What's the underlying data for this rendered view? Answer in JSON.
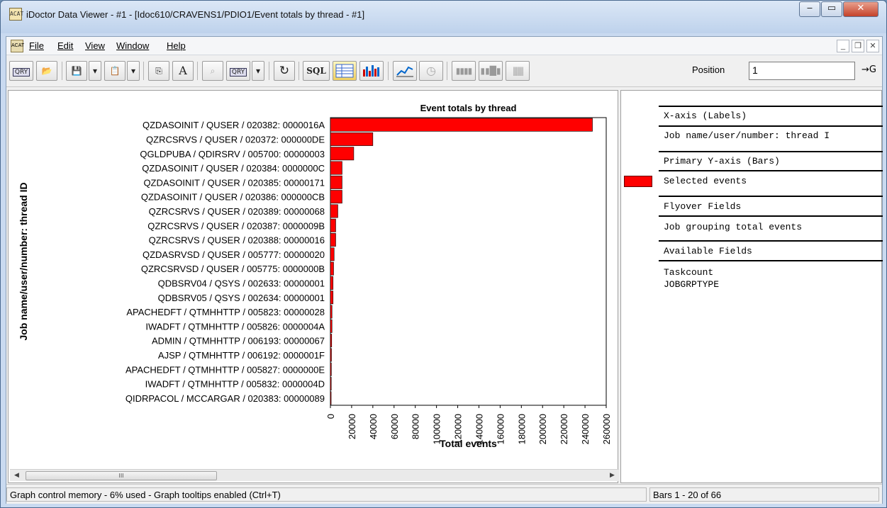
{
  "window": {
    "title": "iDoctor Data Viewer - #1 - [Idoc610/CRAVENS1/PDIO1/Event totals by thread - #1]",
    "icon_text": "ACAT",
    "minimize": "‒",
    "maximize": "▭",
    "close": "✕"
  },
  "menu": {
    "items": [
      "File",
      "Edit",
      "View",
      "Window",
      "Help"
    ],
    "mdi_minimize": "_",
    "mdi_restore": "❐",
    "mdi_close": "✕"
  },
  "toolbar": {
    "qry_label": "QRY",
    "font_label": "A",
    "sql_label": "SQL",
    "position_label": "Position",
    "position_value": "1",
    "go_label": "→G"
  },
  "right_pane": {
    "x_axis_header": "X-axis (Labels)",
    "x_axis_value": "Job name/user/number: thread I",
    "y_axis_header": "Primary Y-axis (Bars)",
    "y_axis_value": "Selected events",
    "flyover_header": "Flyover Fields",
    "flyover_value": "Job grouping total events",
    "available_header": "Available Fields",
    "available_items": [
      "Taskcount",
      "JOBGRPTYPE"
    ]
  },
  "hscroll": {
    "thumb_grip": "III"
  },
  "status": {
    "left": "Graph control memory - 6% used - Graph tooltips enabled (Ctrl+T)",
    "right": "Bars 1 - 20 of 66"
  },
  "chart_data": {
    "type": "bar",
    "orientation": "horizontal",
    "title": "Event totals by thread",
    "xlabel": "Total events",
    "ylabel": "Job name/user/number: thread ID",
    "xlim": [
      0,
      260000
    ],
    "ticks": [
      0,
      20000,
      40000,
      60000,
      80000,
      100000,
      120000,
      140000,
      160000,
      180000,
      200000,
      220000,
      240000,
      260000
    ],
    "bar_color": "#ff0000",
    "grid": false,
    "categories": [
      "QZDASOINIT / QUSER / 020382: 0000016A",
      "QZRCSRVS / QUSER / 020372: 000000DE",
      "QGLDPUBA / QDIRSRV / 005700: 00000003",
      "QZDASOINIT / QUSER / 020384: 0000000C",
      "QZDASOINIT / QUSER / 020385: 00000171",
      "QZDASOINIT / QUSER / 020386: 000000CB",
      "QZRCSRVS / QUSER / 020389: 00000068",
      "QZRCSRVS / QUSER / 020387: 0000009B",
      "QZRCSRVS / QUSER / 020388: 00000016",
      "QZDASRVSD / QUSER / 005777: 00000020",
      "QZRCSRVSD / QUSER / 005775: 0000000B",
      "QDBSRV04 / QSYS / 002633: 00000001",
      "QDBSRV05 / QSYS / 002634: 00000001",
      "APACHEDFT / QTMHHTTP / 005823: 00000028",
      "IWADFT / QTMHHTTP / 005826: 0000004A",
      "ADMIN / QTMHHTTP / 006193: 00000067",
      "AJSP / QTMHHTTP / 006192: 0000001F",
      "APACHEDFT / QTMHHTTP / 005827: 0000000E",
      "IWADFT / QTMHHTTP / 005832: 0000004D",
      "QIDRPACOL / MCCARGAR / 020383: 00000089"
    ],
    "values": [
      247000,
      40000,
      22000,
      11000,
      11000,
      11000,
      7000,
      5000,
      5000,
      3500,
      3000,
      2500,
      2500,
      1500,
      1500,
      1200,
      1000,
      900,
      800,
      700
    ]
  }
}
